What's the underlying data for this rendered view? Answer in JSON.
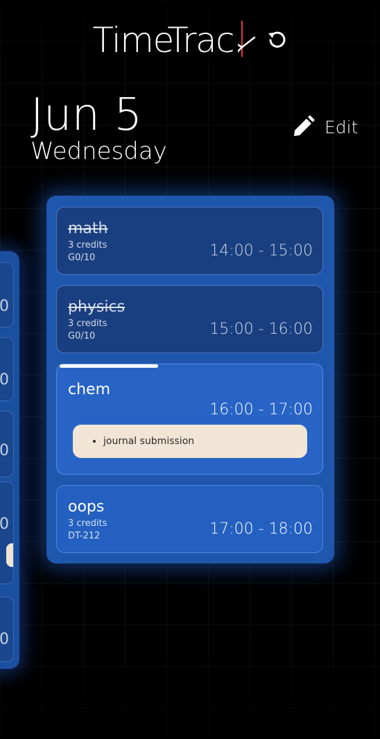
{
  "app": {
    "title": "TimeTrack"
  },
  "date": {
    "main": "Jun 5",
    "weekday": "Wednesday"
  },
  "toolbar": {
    "edit_label": "Edit"
  },
  "icons": {
    "refresh": "refresh-icon",
    "edit": "pencil-icon",
    "clock": "clock-hands-icon"
  },
  "colors": {
    "background": "#000000",
    "card": "#1f57ad",
    "item_done": "#1a3f80",
    "item_active": "#2864c6",
    "note": "#f1e6d5",
    "clock_hand": "#e53935"
  },
  "classes": [
    {
      "name": "math",
      "credits": "3 credits",
      "room": "G0/10",
      "time": "14:00 - 15:00",
      "status": "done"
    },
    {
      "name": "physics",
      "credits": "3 credits",
      "room": "G0/10",
      "time": "15:00 - 16:00",
      "status": "done"
    },
    {
      "name": "chem",
      "time": "16:00 - 17:00",
      "status": "active",
      "progress": 0.37,
      "notes": [
        "journal submission"
      ]
    },
    {
      "name": "oops",
      "credits": "3 credits",
      "room": "DT-212",
      "time": "17:00 - 18:00",
      "status": "upcoming"
    }
  ],
  "previous_day_fragments": [
    "0",
    "0",
    "0",
    "0",
    "0"
  ]
}
